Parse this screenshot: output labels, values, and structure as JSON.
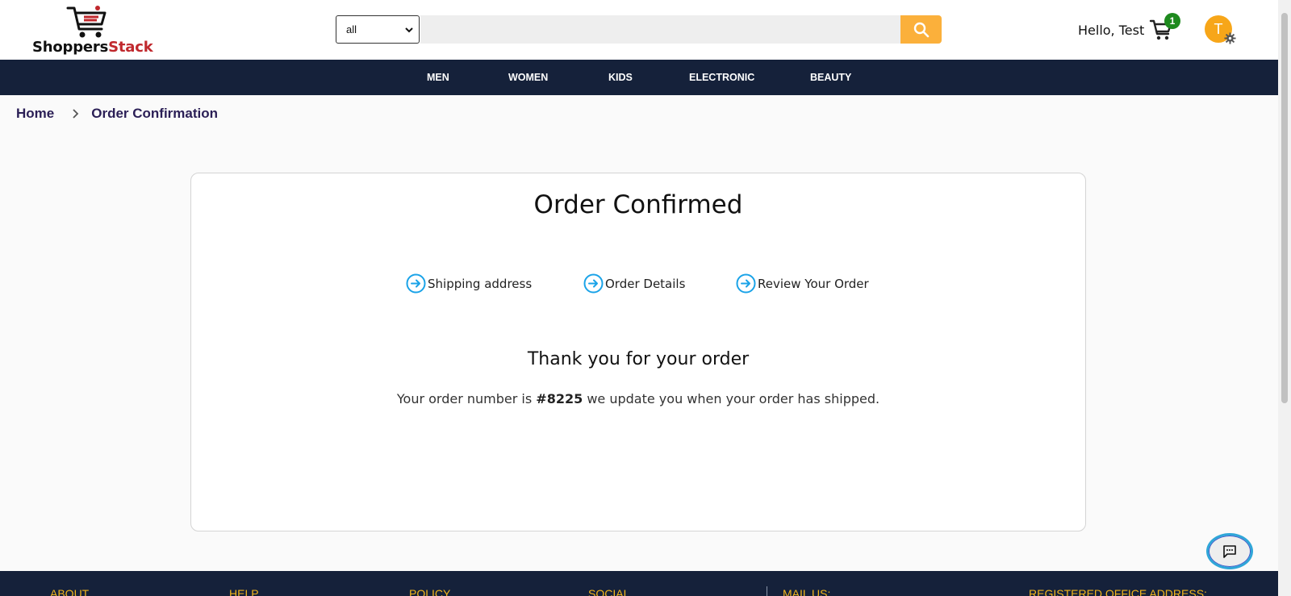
{
  "header": {
    "logo": {
      "text_part1": "Shoppers",
      "text_part2": "Stack"
    },
    "search": {
      "category_value": "all",
      "placeholder": ""
    },
    "greeting": "Hello, Test",
    "cart_count": "1",
    "avatar_initial": "T"
  },
  "nav": {
    "items": [
      {
        "label": "MEN"
      },
      {
        "label": "WOMEN"
      },
      {
        "label": "KIDS"
      },
      {
        "label": "ELECTRONIC"
      },
      {
        "label": "BEAUTY"
      }
    ]
  },
  "breadcrumb": {
    "home": "Home",
    "current": "Order Confirmation"
  },
  "card": {
    "title": "Order Confirmed",
    "steps": [
      {
        "label": "Shipping address"
      },
      {
        "label": "Order Details"
      },
      {
        "label": "Review Your Order"
      }
    ],
    "thanks": "Thank you for your order",
    "order_msg_prefix": "Your order number is",
    "order_number": "#8225",
    "order_msg_suffix": "we update you when your order has shipped."
  },
  "footer": {
    "headings": [
      {
        "label": "ABOUT"
      },
      {
        "label": "HELP"
      },
      {
        "label": "POLICY"
      },
      {
        "label": "SOCIAL"
      },
      {
        "label": "MAIL US:"
      },
      {
        "label": "REGISTERED OFFICE ADDRESS:"
      }
    ]
  },
  "colors": {
    "nav_bg": "#15213a",
    "search_button": "#fbb03b",
    "cart_badge": "#1e8a1e",
    "avatar": "#f7a619",
    "step_icon": "#1aa3e8",
    "footer_heading": "#f2b51c",
    "brand_red": "#c0282d"
  },
  "icons": {
    "logo": "shopping-cart-logo-icon",
    "select_chevron": "chevron-down-icon",
    "search": "search-icon",
    "cart": "cart-icon",
    "avatar_gear": "gear-icon",
    "breadcrumb_sep": "chevron-right-icon",
    "step": "arrow-circle-right-icon",
    "chat": "chat-icon"
  }
}
